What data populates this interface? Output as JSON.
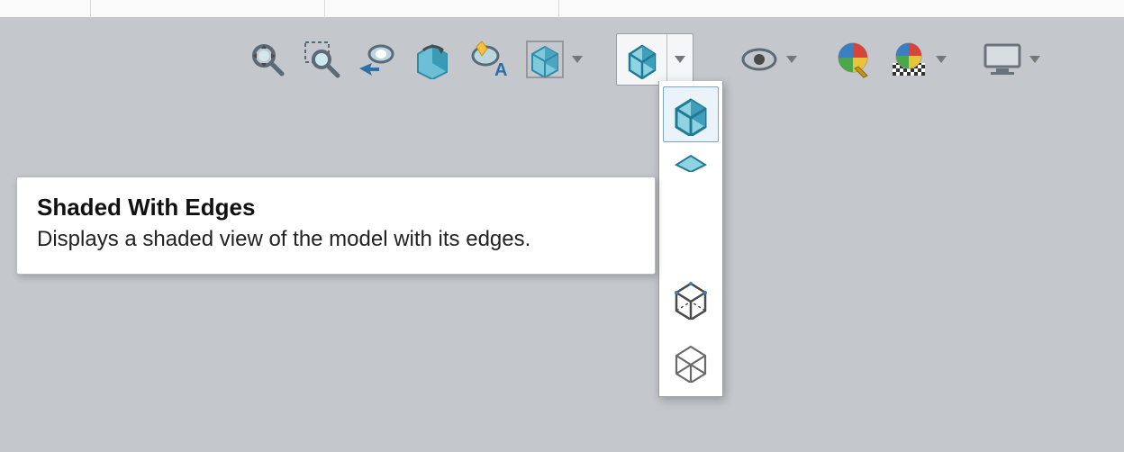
{
  "tooltip": {
    "title": "Shaded With Edges",
    "body": "Displays a shaded view of the model with its edges."
  },
  "toolbar": {
    "items": [
      {
        "name": "zoom-to-fit-icon"
      },
      {
        "name": "zoom-to-area-icon"
      },
      {
        "name": "previous-view-icon"
      },
      {
        "name": "section-view-icon"
      },
      {
        "name": "dynamic-annotation-icon"
      },
      {
        "name": "view-orientation-icon"
      }
    ],
    "display_style": {
      "name": "display-style-icon",
      "options": [
        {
          "name": "shaded-with-edges-icon",
          "selected": true
        },
        {
          "name": "shaded-icon",
          "selected": false
        },
        {
          "name": "hidden-lines-removed-icon",
          "selected": false
        },
        {
          "name": "hidden-lines-visible-icon",
          "selected": false
        },
        {
          "name": "wireframe-icon",
          "selected": false
        }
      ]
    },
    "right_items": [
      {
        "name": "hide-show-items-icon"
      },
      {
        "name": "edit-appearance-icon"
      },
      {
        "name": "apply-scene-icon"
      },
      {
        "name": "view-settings-icon"
      }
    ]
  },
  "colors": {
    "cube_fill": "#5fb5cf",
    "cube_dark": "#2f8aa8",
    "accent_red": "#d8433a",
    "accent_green": "#4aa84a",
    "accent_yellow": "#e8c43a",
    "gray": "#777777"
  }
}
